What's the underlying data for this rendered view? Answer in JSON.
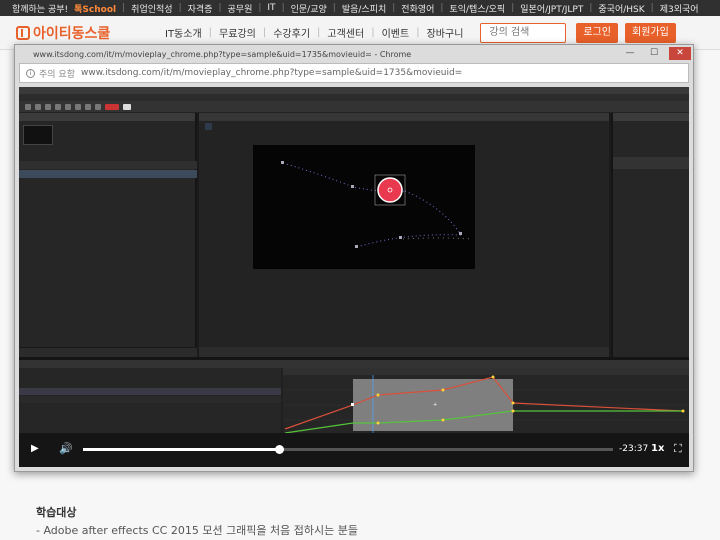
{
  "category_strip": {
    "slogan": "함께하는 공부!",
    "brand": "톡School",
    "items": [
      "취업인적성",
      "자격증",
      "공무원",
      "IT",
      "인문/교양",
      "발음/스피치",
      "전화영어",
      "토익/텝스/오픽",
      "일본어/JPT/JLPT",
      "중국어/HSK",
      "제3외국어"
    ]
  },
  "nav": {
    "logo_text": "아이티동스쿨",
    "menu": [
      "IT동소개",
      "무료강의",
      "수강후기",
      "고객센터",
      "이벤트",
      "장바구니"
    ],
    "search_placeholder": "강의 검색",
    "login": "로그인",
    "signup": "회원가입"
  },
  "popup": {
    "title": "www.itsdong.com/it/m/movieplay_chrome.php?type=sample&uid=1735&movieuid= - Chrome",
    "secure_label": "주의 요함",
    "url": "www.itsdong.com/it/m/movieplay_chrome.php?type=sample&uid=1735&movieuid="
  },
  "player": {
    "time_remaining": "-23:37",
    "speed": "1x",
    "progress_fraction": 0.37
  },
  "page": {
    "section_title": "학습대상",
    "section_desc": "- Adobe after effects CC 2015 모션 그래픽을 처음 접하시는 분들"
  }
}
